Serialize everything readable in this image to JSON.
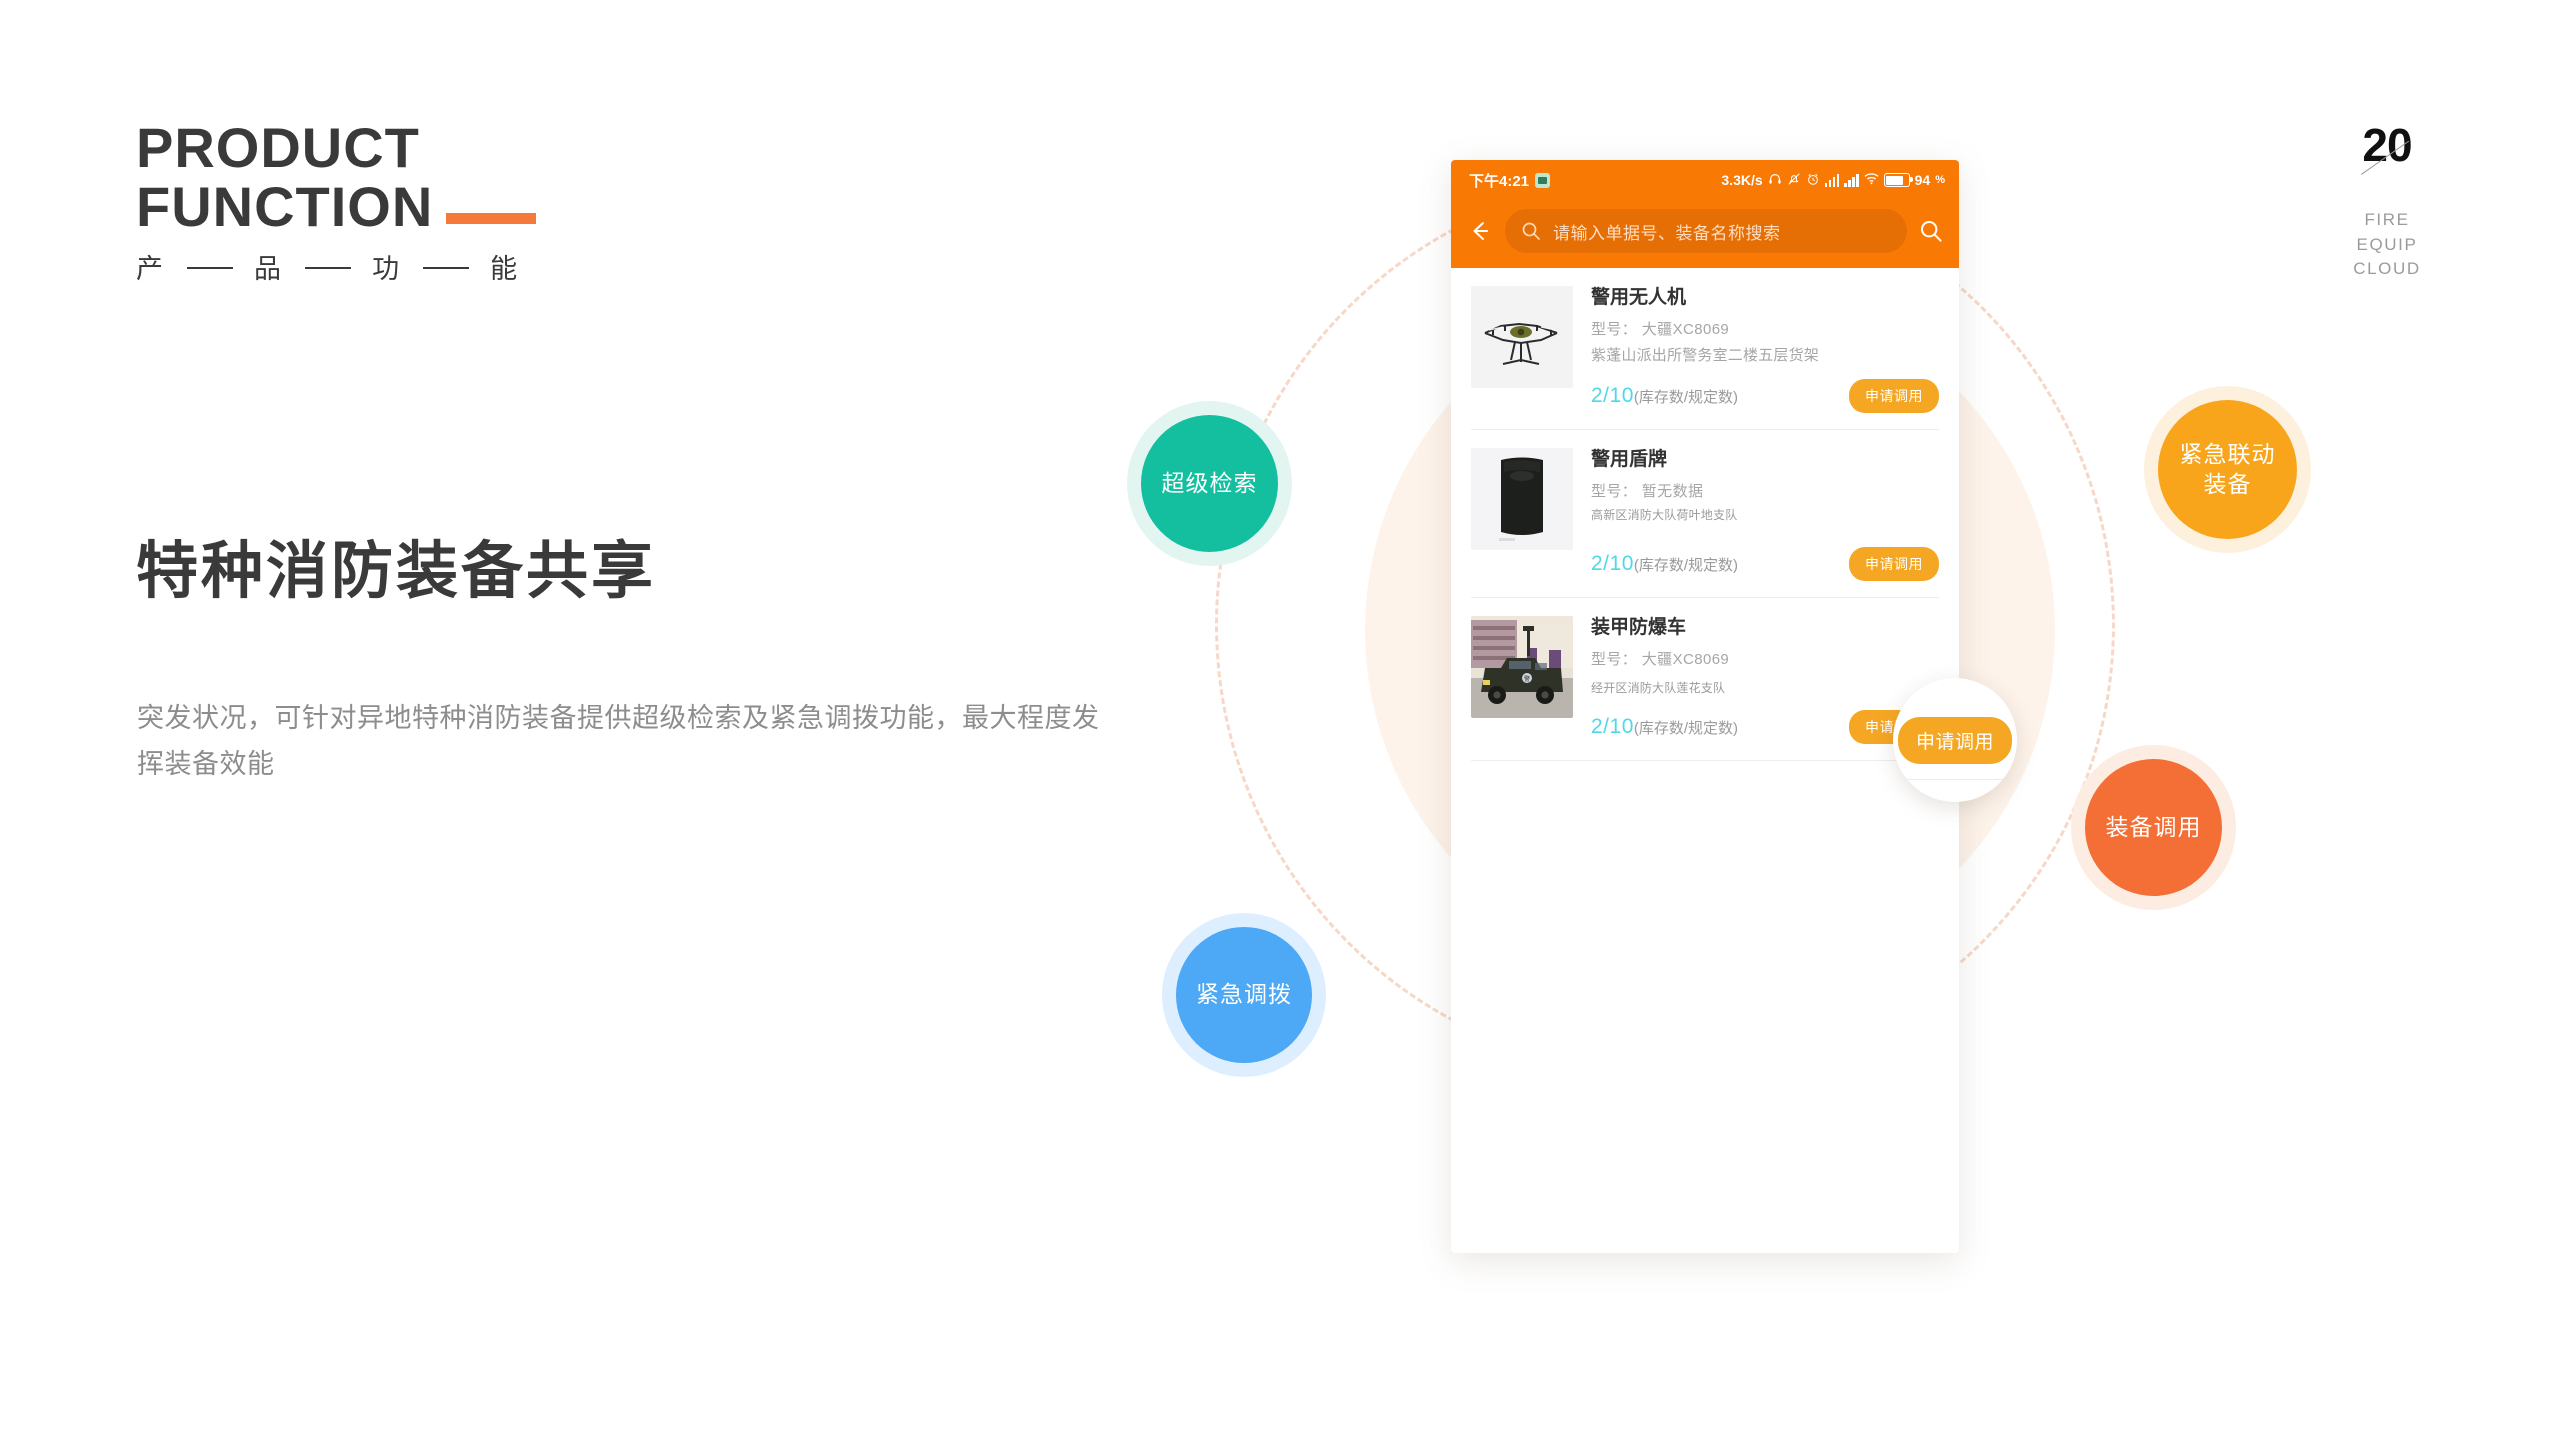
{
  "eyebrow": {
    "line1": "PRODUCT",
    "line2": "FUNCTION",
    "cn": [
      "产",
      "品",
      "功",
      "能"
    ]
  },
  "headline": "特种消防装备共享",
  "description": "突发状况，可针对异地特种消防装备提供超级检索及紧急调拨功能，最大程度发挥装备效能",
  "corner": {
    "number": "20",
    "sub_line1": "FIRE",
    "sub_line2": "EQUIP",
    "sub_line3": "CLOUD"
  },
  "phone": {
    "status": {
      "time": "下午4:21",
      "app_icon": "app-badge-icon",
      "net_speed": "3.3K/s",
      "icons": [
        "headphone-icon",
        "bell-muted-icon",
        "alarm-clock-icon",
        "hd-signal-icon",
        "signal-icon",
        "wifi-icon",
        "battery-icon"
      ],
      "battery_percent": "94",
      "battery_unit": "%"
    },
    "header": {
      "back_icon": "back-arrow-icon",
      "search_icon": "search-icon",
      "search_placeholder": "请输入单据号、装备名称搜索",
      "search_value": "",
      "right_search_icon": "search-icon"
    },
    "cards": [
      {
        "thumb": "drone-photo",
        "title": "警用无人机",
        "model": "型号： 大疆XC8069",
        "location": "紫蓬山派出所警务室二楼五层货架",
        "location_size": "big",
        "stock": "2/10",
        "stock_note": "(库存数/规定数)",
        "button": "申请调用"
      },
      {
        "thumb": "shield-photo",
        "title": "警用盾牌",
        "model": "型号： 暂无数据",
        "location": "高新区消防大队荷叶地支队",
        "location_size": "small",
        "stock": "2/10",
        "stock_note": "(库存数/规定数)",
        "button": "申请调用"
      },
      {
        "thumb": "armored-vehicle-photo",
        "title": "装甲防爆车",
        "model": "型号： 大疆XC8069",
        "location": "经开区消防大队莲花支队",
        "location_size": "small",
        "stock": "2/10",
        "stock_note": "(库存数/规定数)",
        "button": "申请调用"
      }
    ]
  },
  "magnifier": {
    "label": "申请调用"
  },
  "bubbles": [
    {
      "label": "超级检索",
      "color": "#14bfa0",
      "ring": "#e2f5f1"
    },
    {
      "label": "紧急调拨",
      "color": "#4da8f5",
      "ring": "#ddeeff"
    },
    {
      "label": "紧急联动\n装备",
      "color": "#f9a51b",
      "ring": "#fdf1dd",
      "line1": "紧急联动",
      "line2": "装备"
    },
    {
      "label": "装备调用",
      "color": "#f36f35",
      "ring": "#fdece2"
    }
  ],
  "colors": {
    "accent_orange": "#f4793b",
    "header_orange": "#f97905",
    "button_amber": "#f5a623",
    "stock_cyan": "#4ed9e6",
    "cream": "#fdf3ea",
    "dashed": "#f7d7c7"
  }
}
